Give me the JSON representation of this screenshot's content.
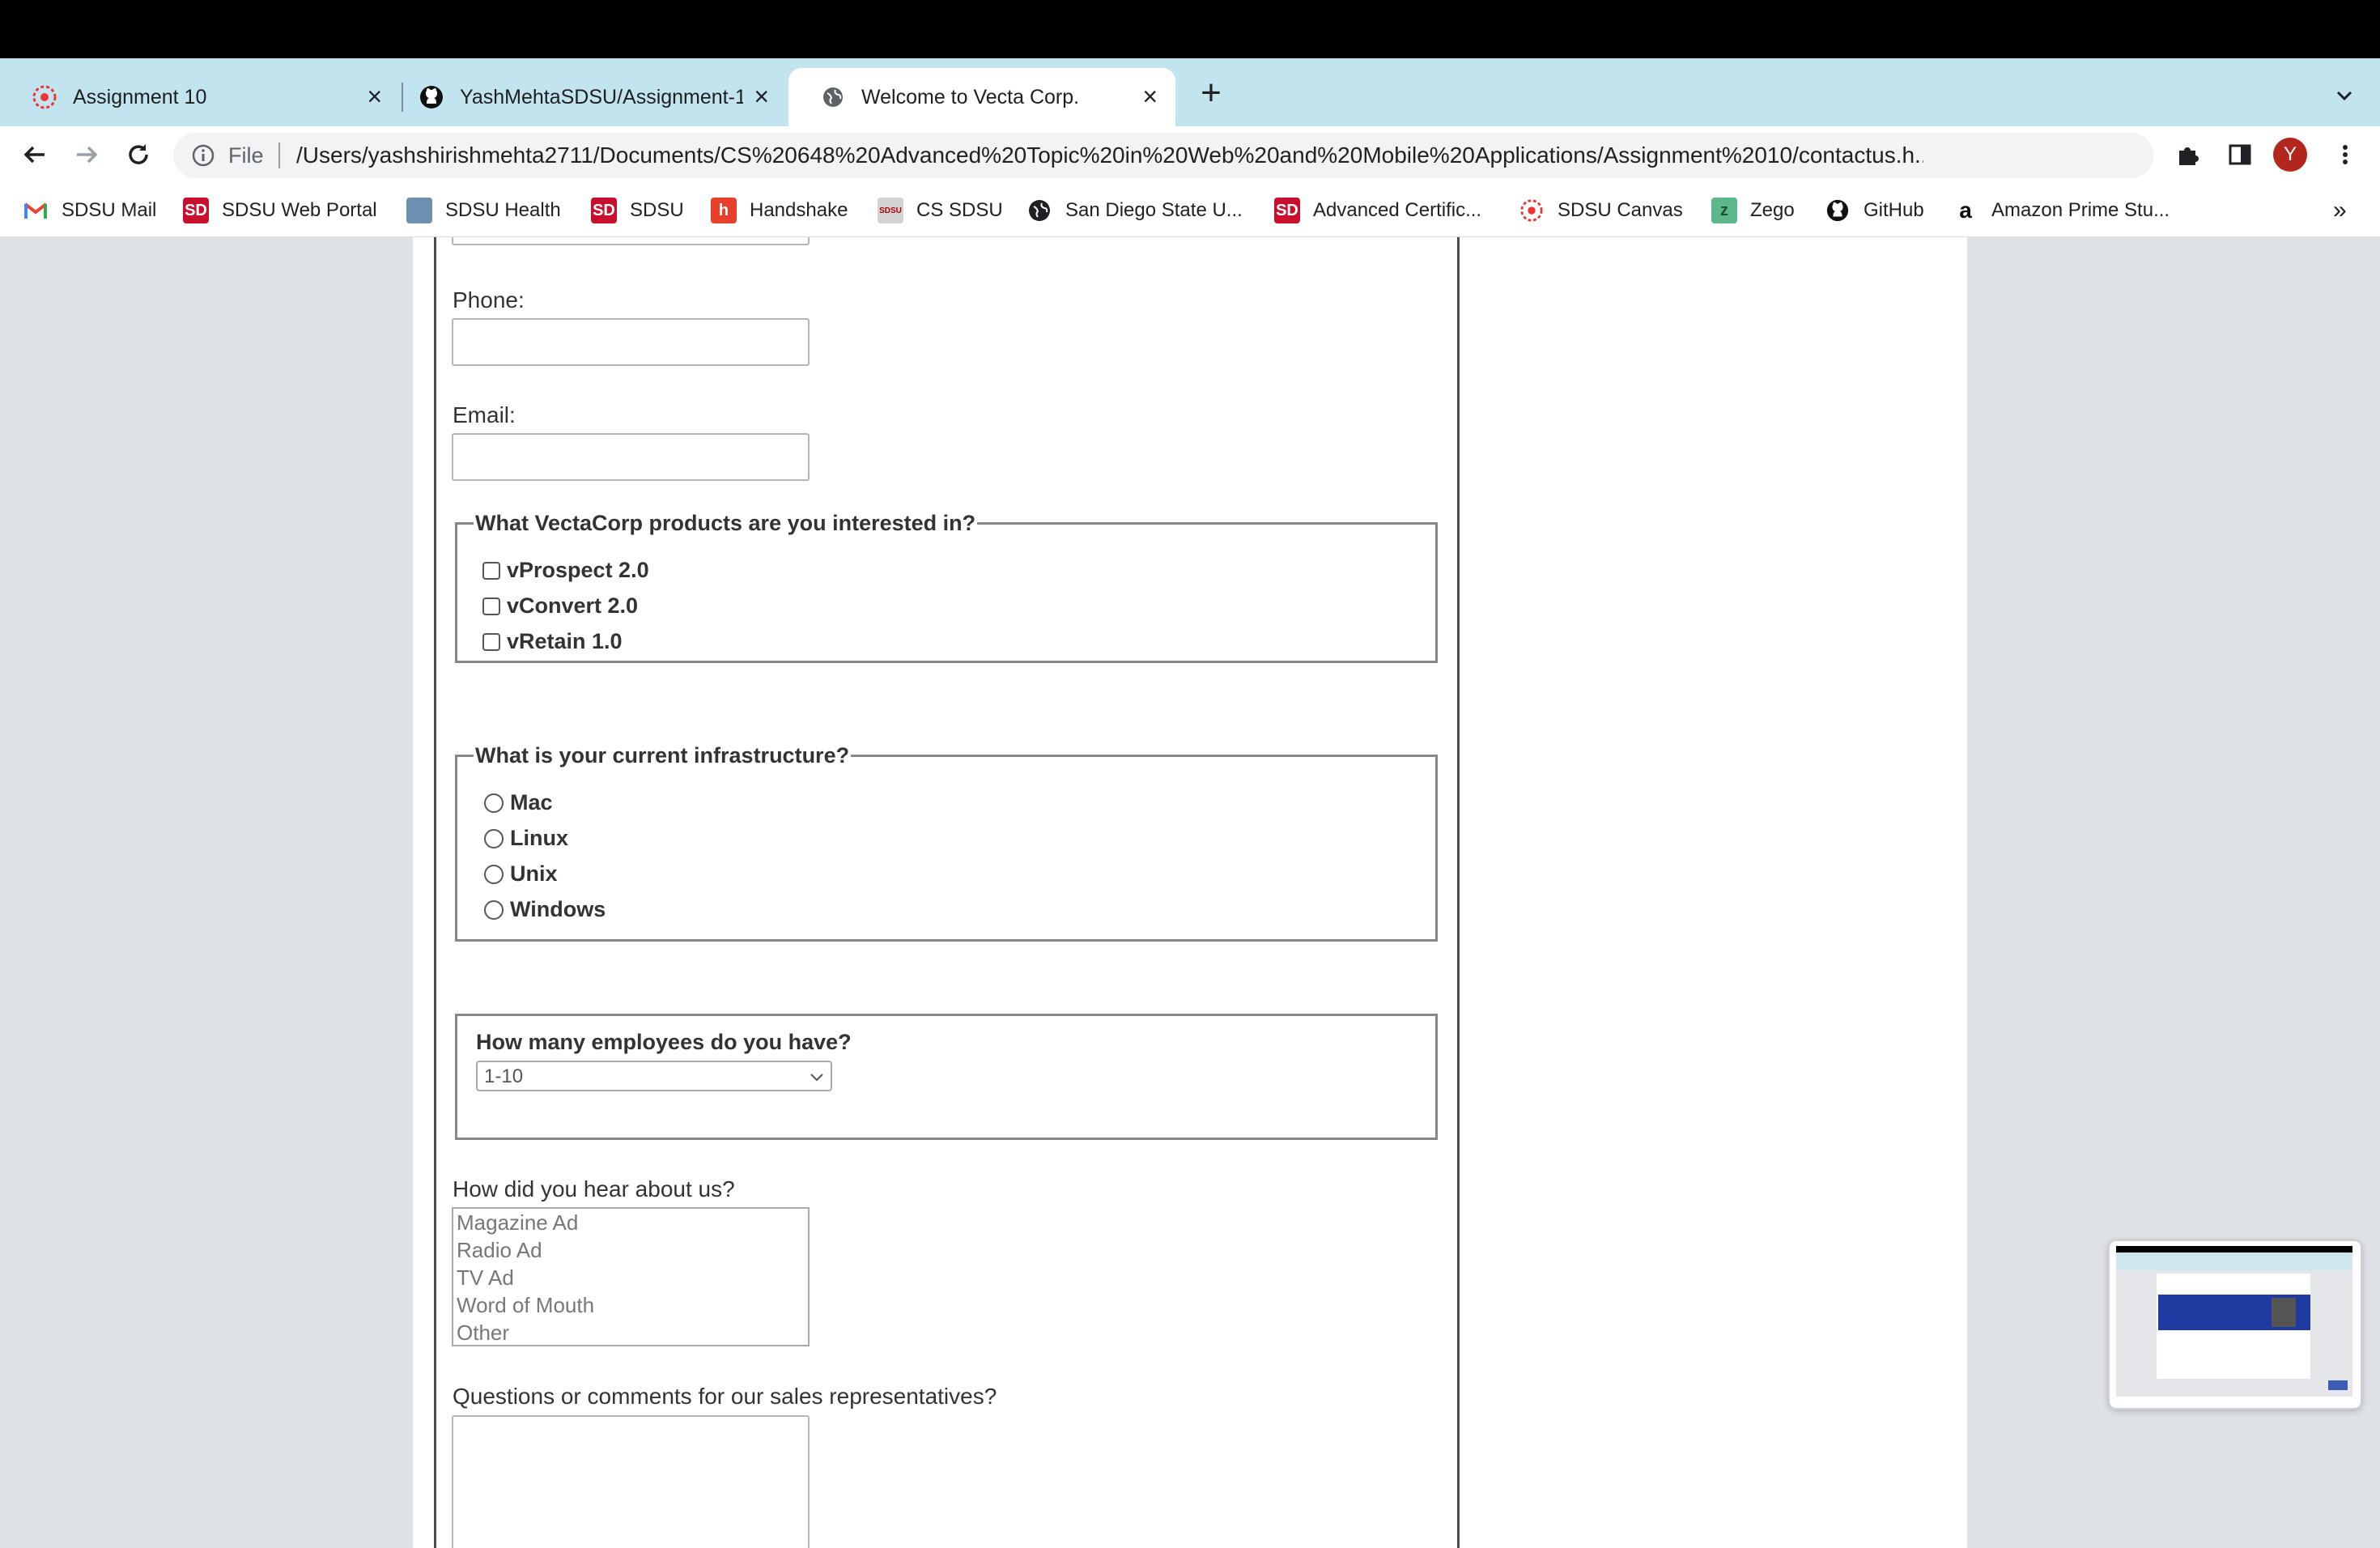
{
  "tabs": [
    {
      "title": "Assignment 10",
      "icon": "canvas-icon"
    },
    {
      "title": "YashMehtaSDSU/Assignment-1",
      "icon": "github-icon"
    },
    {
      "title": "Welcome to Vecta Corp.",
      "icon": "globe-icon",
      "active": true
    }
  ],
  "addressbar": {
    "scheme_label": "File",
    "url": "/Users/yashshirishmehta2711/Documents/CS%20648%20Advanced%20Topic%20in%20Web%20and%20Mobile%20Applications/Assignment%2010/contactus.h..."
  },
  "profile": {
    "initial": "Y",
    "color": "#b3261e"
  },
  "bookmarks": [
    {
      "label": "SDSU Mail",
      "icon": "gmail-icon"
    },
    {
      "label": "SDSU Web Portal",
      "icon": "sd-icon"
    },
    {
      "label": "SDSU Health",
      "icon": "health-icon"
    },
    {
      "label": "SDSU",
      "icon": "sd-icon"
    },
    {
      "label": "Handshake",
      "icon": "handshake-icon"
    },
    {
      "label": "CS SDSU",
      "icon": "sdsu-cs-icon"
    },
    {
      "label": "San Diego State U...",
      "icon": "globe-icon"
    },
    {
      "label": "Advanced Certific...",
      "icon": "sd-icon"
    },
    {
      "label": "SDSU Canvas",
      "icon": "canvas-icon"
    },
    {
      "label": "Zego",
      "icon": "zego-icon"
    },
    {
      "label": "GitHub",
      "icon": "github-icon"
    },
    {
      "label": "Amazon Prime Stu...",
      "icon": "amazon-icon"
    }
  ],
  "bookmarks_overflow": "»",
  "form": {
    "phone_label": "Phone:",
    "email_label": "Email:",
    "products": {
      "legend": "What VectaCorp products are you interested in?",
      "options": [
        "vProspect 2.0",
        "vConvert 2.0",
        "vRetain 1.0"
      ]
    },
    "infrastructure": {
      "legend": "What is your current infrastructure?",
      "options": [
        "Mac",
        "Linux",
        "Unix",
        "Windows"
      ]
    },
    "employees": {
      "question": "How many employees do you have?",
      "selected": "1-10"
    },
    "hear": {
      "question": "How did you hear about us?",
      "options": [
        "Magazine Ad",
        "Radio Ad",
        "TV Ad",
        "Word of Mouth",
        "Other"
      ]
    },
    "comments_label": "Questions or comments for our sales representatives?"
  },
  "colors": {
    "tabstrip": "#c2e4ef",
    "page_background": "#dee1e6",
    "fieldset_border": "#888888"
  }
}
